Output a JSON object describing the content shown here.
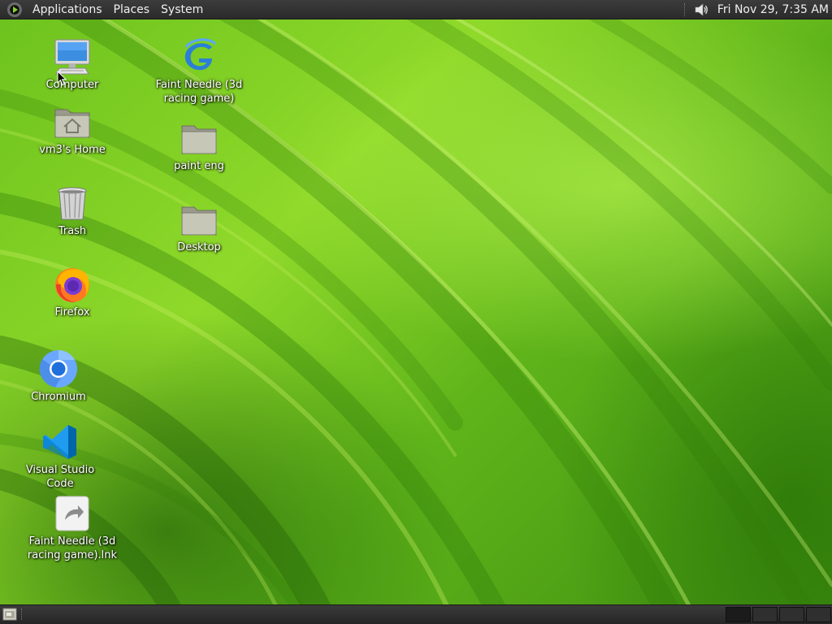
{
  "top_panel": {
    "menus": [
      "Applications",
      "Places",
      "System"
    ],
    "clock": "Fri Nov 29,  7:35 AM",
    "icons": [
      "distro-logo-icon",
      "speaker-icon"
    ]
  },
  "desktop": {
    "icons": [
      {
        "label": "Computer",
        "icon": "computer-icon"
      },
      {
        "label": "vm3's Home",
        "icon": "home-folder-icon"
      },
      {
        "label": "Trash",
        "icon": "trash-icon"
      },
      {
        "label": "Firefox",
        "icon": "firefox-icon"
      },
      {
        "label": "Chromium",
        "icon": "chromium-icon"
      },
      {
        "label": "Visual Studio Code",
        "icon": "vscode-icon"
      },
      {
        "label": "Faint Needle (3d racing game).lnk",
        "icon": "shortcut-file-icon"
      },
      {
        "label": "Faint Needle (3d racing game)",
        "icon": "faint-needle-game-icon"
      },
      {
        "label": "paint eng",
        "icon": "folder-icon"
      },
      {
        "label": "Desktop",
        "icon": "folder-icon"
      }
    ]
  },
  "bottom_panel": {
    "icons": [
      "show-desktop-icon"
    ],
    "workspaces": 4,
    "active_workspace": 1
  },
  "colors": {
    "panel": "#2e2e2e",
    "panel_text": "#f0f0f0",
    "wallpaper_green": "#7ccf22"
  }
}
